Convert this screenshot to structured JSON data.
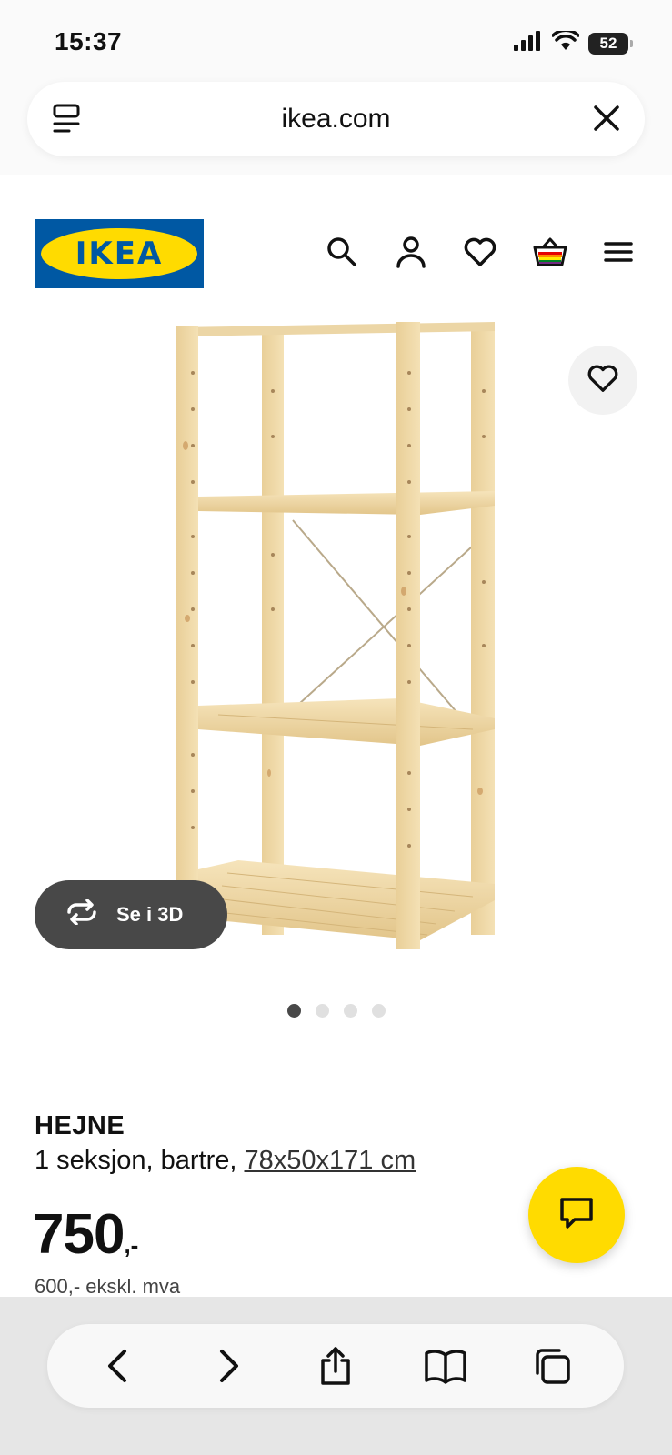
{
  "status_bar": {
    "time": "15:37",
    "battery": "52"
  },
  "browser": {
    "url": "ikea.com"
  },
  "header": {
    "logo_text": "IKEA",
    "icons": [
      "search-icon",
      "account-icon",
      "heart-icon",
      "basket-icon",
      "menu-icon"
    ]
  },
  "product": {
    "name": "HEJNE",
    "description": "1 seksjon, bartre, ",
    "dimensions": "78x50x171 cm",
    "price": "750",
    "price_suffix": ",-",
    "price_ex_vat": "600,- ekskl. mva",
    "view_3d_label": "Se i 3D",
    "image_count": 4,
    "active_image": 1
  },
  "colors": {
    "brand_blue": "#0058a3",
    "brand_yellow": "#ffdb00",
    "dark_pill": "#484848"
  },
  "bottom_toolbar": {
    "icons": [
      "back-icon",
      "forward-icon",
      "share-icon",
      "bookmarks-icon",
      "tabs-icon"
    ]
  }
}
